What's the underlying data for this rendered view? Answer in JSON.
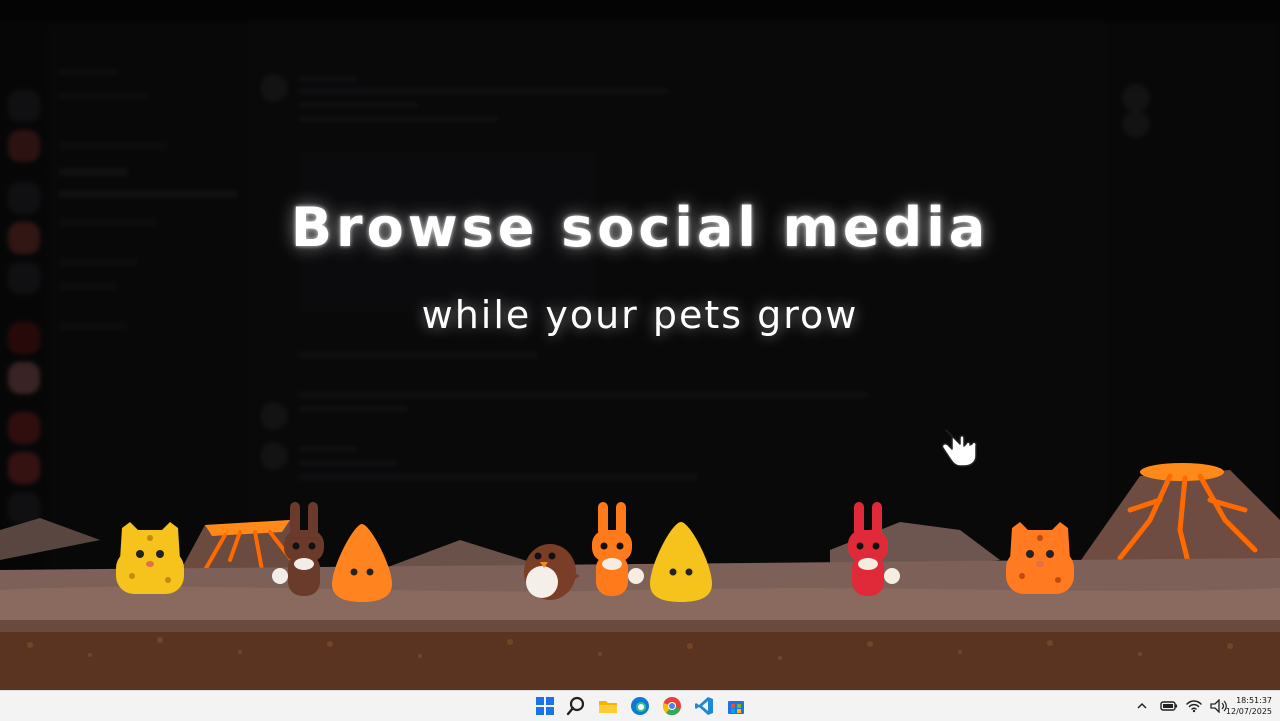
{
  "headline": {
    "title": "Browse social media",
    "subtitle": "while your pets grow"
  },
  "pets": [
    {
      "kind": "cat",
      "color": "yellow"
    },
    {
      "kind": "bunny",
      "color": "brown"
    },
    {
      "kind": "slime",
      "color": "orange"
    },
    {
      "kind": "bird",
      "color": "brown"
    },
    {
      "kind": "bunny",
      "color": "orange"
    },
    {
      "kind": "slime",
      "color": "yellow"
    },
    {
      "kind": "bunny",
      "color": "red"
    },
    {
      "kind": "cat",
      "color": "orange"
    }
  ],
  "taskbar": {
    "apps": [
      "start-icon",
      "search-icon",
      "file-explorer-icon",
      "edge-icon",
      "chrome-icon",
      "vscode-icon",
      "store-icon"
    ],
    "tray_icons": [
      "chevron-up-icon",
      "battery-icon",
      "wifi-icon",
      "volume-icon"
    ],
    "clock_time": "18:51:37",
    "clock_date": "12/07/2025"
  },
  "colors": {
    "lava": "#ff6a00",
    "rock": "#7a5a50",
    "dirt": "#5a3420",
    "taskbar": "#f3f3f3"
  }
}
